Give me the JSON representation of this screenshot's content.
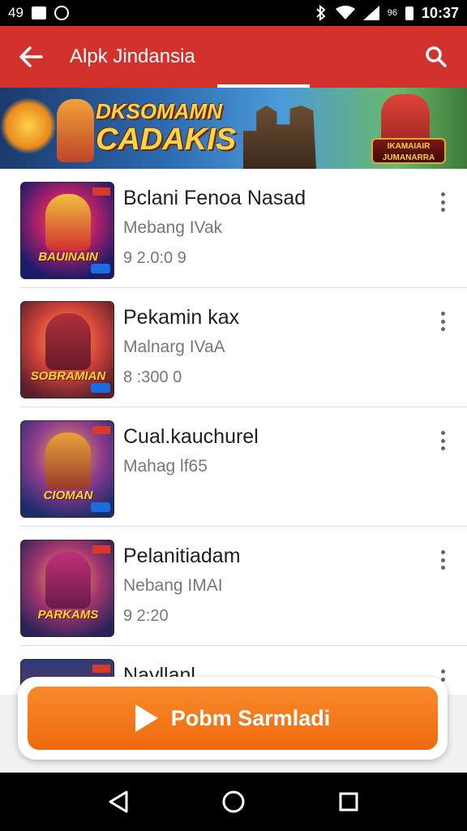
{
  "status_bar": {
    "left_text": "49",
    "signal_label": "96",
    "time": "10:37"
  },
  "app_bar": {
    "title": "Alpk Jindansia"
  },
  "banner": {
    "heading_line1": "DKSOMAMN",
    "heading_line2": "CADAKIS",
    "brand_text": "IKAMAIAIR JUMANARRA"
  },
  "list": {
    "items": [
      {
        "title": "Bclani Fenoa Nasad",
        "subtitle": "Mebang IVak",
        "meta": "9 2.0:0 9",
        "thumb_caption": "BAUINAIN"
      },
      {
        "title": "Pekamin kax",
        "subtitle": "Malnarg IVaA",
        "meta": "8 :300 0",
        "thumb_caption": "SOBRAMIAN"
      },
      {
        "title": "Cual.kauchurel",
        "subtitle": "Mahag lf65",
        "meta": "",
        "thumb_caption": "CIOMAN"
      },
      {
        "title": "Pelanitiadam",
        "subtitle": "Nebang IMAI",
        "meta": "9 2:20",
        "thumb_caption": "PARKAMS"
      },
      {
        "title": "Nayllanl",
        "subtitle": "",
        "meta": "",
        "thumb_caption": ""
      }
    ]
  },
  "action": {
    "label": "Pobm Sarmladi"
  },
  "colors": {
    "app_bar": "#d3322c",
    "action": "#f07a1a"
  }
}
